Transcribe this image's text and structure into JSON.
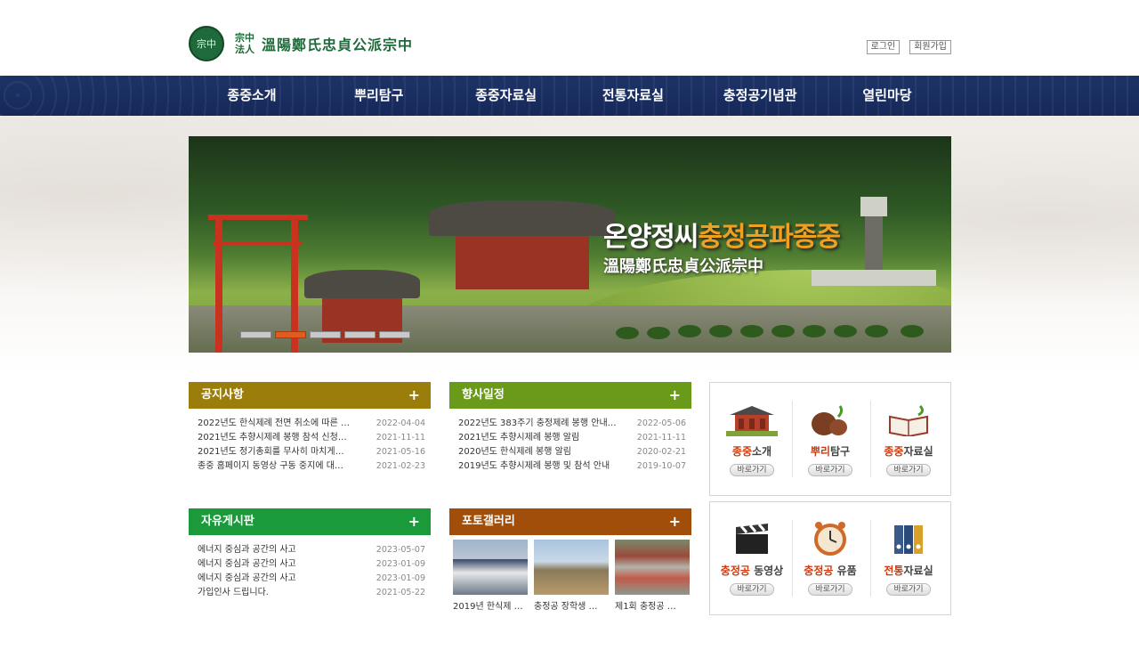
{
  "header": {
    "logo_mark": "宗中",
    "logo_sub": "宗中法人",
    "logo_name": "溫陽鄭氏忠貞公派宗中",
    "login": "로그인",
    "signup": "회원가입"
  },
  "nav": {
    "items": [
      "종중소개",
      "뿌리탐구",
      "종중자료실",
      "전통자료실",
      "충정공기념관",
      "열린마당"
    ]
  },
  "banner": {
    "title_prefix": "온양정씨",
    "title_highlight": "충정공파종중",
    "subtitle": "溫陽鄭氏忠貞公派宗中",
    "slide_count": 5,
    "active_slide": 2
  },
  "boards": {
    "notice": {
      "title": "공지사항",
      "plus": "+",
      "color": "#9a7d0a",
      "rows": [
        {
          "title": "2022년도 한식제례 전면 취소에 따른 …",
          "date": "2022-04-04"
        },
        {
          "title": "2021년도 추향시제례 봉행 참석 신청…",
          "date": "2021-11-11"
        },
        {
          "title": "2021년도 정기총회를 무사히 마치게…",
          "date": "2021-05-16"
        },
        {
          "title": "종중 홈페이지 동영상 구동 중지에 대…",
          "date": "2021-02-23"
        }
      ]
    },
    "events": {
      "title": "향사일정",
      "plus": "+",
      "color": "#6a9a1a",
      "rows": [
        {
          "title": "2022년도 383주기 충정제례 봉행 안내…",
          "date": "2022-05-06"
        },
        {
          "title": "2021년도 추향시제례 봉행 알림",
          "date": "2021-11-11"
        },
        {
          "title": "2020년도 한식제례 봉행 알림",
          "date": "2020-02-21"
        },
        {
          "title": "2019년도 추향시제례 봉행 및 참석 안내",
          "date": "2019-10-07"
        }
      ]
    },
    "free": {
      "title": "자유게시판",
      "plus": "+",
      "color": "#1a9a3a",
      "rows": [
        {
          "title": "에너지 중심과 공간의 사고",
          "date": "2023-05-07"
        },
        {
          "title": "에너지 중심과 공간의 사고",
          "date": "2023-01-09"
        },
        {
          "title": "에너지 중심과 공간의 사고",
          "date": "2023-01-09"
        },
        {
          "title": "가입인사 드립니다.",
          "date": "2021-05-22"
        }
      ]
    },
    "gallery": {
      "title": "포토갤러리",
      "plus": "+",
      "color": "#a04e0a",
      "items": [
        {
          "caption": "2019년 한식제 …"
        },
        {
          "caption": "충정공 장학생 …"
        },
        {
          "caption": "제1회 충정공 …"
        }
      ]
    }
  },
  "quick": {
    "row1": [
      {
        "accent": "종중",
        "rest": "소개",
        "btn": "바로가기",
        "icon": "hall-icon"
      },
      {
        "accent": "뿌리",
        "rest": "탐구",
        "btn": "바로가기",
        "icon": "pots-icon"
      },
      {
        "accent": "종중",
        "rest": "자료실",
        "btn": "바로가기",
        "icon": "book-icon"
      }
    ],
    "row2": [
      {
        "accent": "충정공",
        "rest": " 동영상",
        "btn": "바로가기",
        "icon": "clapper-icon"
      },
      {
        "accent": "충정공",
        "rest": " 유품",
        "btn": "바로가기",
        "icon": "clock-icon"
      },
      {
        "accent": "전통",
        "rest": "자료실",
        "btn": "바로가기",
        "icon": "binders-icon"
      }
    ]
  }
}
